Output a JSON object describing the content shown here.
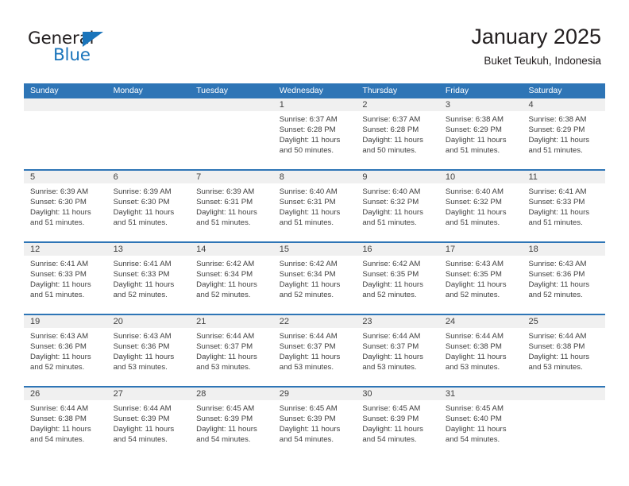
{
  "brand": {
    "name_top": "General",
    "name_bottom": "Blue",
    "accent_color": "#1b75bb"
  },
  "header": {
    "title": "January 2025",
    "subtitle": "Buket Teukuh, Indonesia"
  },
  "theme": {
    "header_row_color": "#2e75b6",
    "daynum_band_color": "#f0f0f0",
    "text_color": "#404040"
  },
  "calendar": {
    "day_headers": [
      "Sunday",
      "Monday",
      "Tuesday",
      "Wednesday",
      "Thursday",
      "Friday",
      "Saturday"
    ],
    "weeks": [
      [
        {
          "day": "",
          "empty": true,
          "lines": []
        },
        {
          "day": "",
          "empty": true,
          "lines": []
        },
        {
          "day": "",
          "empty": true,
          "lines": []
        },
        {
          "day": "1",
          "lines": [
            "Sunrise: 6:37 AM",
            "Sunset: 6:28 PM",
            "Daylight: 11 hours",
            "and 50 minutes."
          ]
        },
        {
          "day": "2",
          "lines": [
            "Sunrise: 6:37 AM",
            "Sunset: 6:28 PM",
            "Daylight: 11 hours",
            "and 50 minutes."
          ]
        },
        {
          "day": "3",
          "lines": [
            "Sunrise: 6:38 AM",
            "Sunset: 6:29 PM",
            "Daylight: 11 hours",
            "and 51 minutes."
          ]
        },
        {
          "day": "4",
          "lines": [
            "Sunrise: 6:38 AM",
            "Sunset: 6:29 PM",
            "Daylight: 11 hours",
            "and 51 minutes."
          ]
        }
      ],
      [
        {
          "day": "5",
          "lines": [
            "Sunrise: 6:39 AM",
            "Sunset: 6:30 PM",
            "Daylight: 11 hours",
            "and 51 minutes."
          ]
        },
        {
          "day": "6",
          "lines": [
            "Sunrise: 6:39 AM",
            "Sunset: 6:30 PM",
            "Daylight: 11 hours",
            "and 51 minutes."
          ]
        },
        {
          "day": "7",
          "lines": [
            "Sunrise: 6:39 AM",
            "Sunset: 6:31 PM",
            "Daylight: 11 hours",
            "and 51 minutes."
          ]
        },
        {
          "day": "8",
          "lines": [
            "Sunrise: 6:40 AM",
            "Sunset: 6:31 PM",
            "Daylight: 11 hours",
            "and 51 minutes."
          ]
        },
        {
          "day": "9",
          "lines": [
            "Sunrise: 6:40 AM",
            "Sunset: 6:32 PM",
            "Daylight: 11 hours",
            "and 51 minutes."
          ]
        },
        {
          "day": "10",
          "lines": [
            "Sunrise: 6:40 AM",
            "Sunset: 6:32 PM",
            "Daylight: 11 hours",
            "and 51 minutes."
          ]
        },
        {
          "day": "11",
          "lines": [
            "Sunrise: 6:41 AM",
            "Sunset: 6:33 PM",
            "Daylight: 11 hours",
            "and 51 minutes."
          ]
        }
      ],
      [
        {
          "day": "12",
          "lines": [
            "Sunrise: 6:41 AM",
            "Sunset: 6:33 PM",
            "Daylight: 11 hours",
            "and 51 minutes."
          ]
        },
        {
          "day": "13",
          "lines": [
            "Sunrise: 6:41 AM",
            "Sunset: 6:33 PM",
            "Daylight: 11 hours",
            "and 52 minutes."
          ]
        },
        {
          "day": "14",
          "lines": [
            "Sunrise: 6:42 AM",
            "Sunset: 6:34 PM",
            "Daylight: 11 hours",
            "and 52 minutes."
          ]
        },
        {
          "day": "15",
          "lines": [
            "Sunrise: 6:42 AM",
            "Sunset: 6:34 PM",
            "Daylight: 11 hours",
            "and 52 minutes."
          ]
        },
        {
          "day": "16",
          "lines": [
            "Sunrise: 6:42 AM",
            "Sunset: 6:35 PM",
            "Daylight: 11 hours",
            "and 52 minutes."
          ]
        },
        {
          "day": "17",
          "lines": [
            "Sunrise: 6:43 AM",
            "Sunset: 6:35 PM",
            "Daylight: 11 hours",
            "and 52 minutes."
          ]
        },
        {
          "day": "18",
          "lines": [
            "Sunrise: 6:43 AM",
            "Sunset: 6:36 PM",
            "Daylight: 11 hours",
            "and 52 minutes."
          ]
        }
      ],
      [
        {
          "day": "19",
          "lines": [
            "Sunrise: 6:43 AM",
            "Sunset: 6:36 PM",
            "Daylight: 11 hours",
            "and 52 minutes."
          ]
        },
        {
          "day": "20",
          "lines": [
            "Sunrise: 6:43 AM",
            "Sunset: 6:36 PM",
            "Daylight: 11 hours",
            "and 53 minutes."
          ]
        },
        {
          "day": "21",
          "lines": [
            "Sunrise: 6:44 AM",
            "Sunset: 6:37 PM",
            "Daylight: 11 hours",
            "and 53 minutes."
          ]
        },
        {
          "day": "22",
          "lines": [
            "Sunrise: 6:44 AM",
            "Sunset: 6:37 PM",
            "Daylight: 11 hours",
            "and 53 minutes."
          ]
        },
        {
          "day": "23",
          "lines": [
            "Sunrise: 6:44 AM",
            "Sunset: 6:37 PM",
            "Daylight: 11 hours",
            "and 53 minutes."
          ]
        },
        {
          "day": "24",
          "lines": [
            "Sunrise: 6:44 AM",
            "Sunset: 6:38 PM",
            "Daylight: 11 hours",
            "and 53 minutes."
          ]
        },
        {
          "day": "25",
          "lines": [
            "Sunrise: 6:44 AM",
            "Sunset: 6:38 PM",
            "Daylight: 11 hours",
            "and 53 minutes."
          ]
        }
      ],
      [
        {
          "day": "26",
          "lines": [
            "Sunrise: 6:44 AM",
            "Sunset: 6:38 PM",
            "Daylight: 11 hours",
            "and 54 minutes."
          ]
        },
        {
          "day": "27",
          "lines": [
            "Sunrise: 6:44 AM",
            "Sunset: 6:39 PM",
            "Daylight: 11 hours",
            "and 54 minutes."
          ]
        },
        {
          "day": "28",
          "lines": [
            "Sunrise: 6:45 AM",
            "Sunset: 6:39 PM",
            "Daylight: 11 hours",
            "and 54 minutes."
          ]
        },
        {
          "day": "29",
          "lines": [
            "Sunrise: 6:45 AM",
            "Sunset: 6:39 PM",
            "Daylight: 11 hours",
            "and 54 minutes."
          ]
        },
        {
          "day": "30",
          "lines": [
            "Sunrise: 6:45 AM",
            "Sunset: 6:39 PM",
            "Daylight: 11 hours",
            "and 54 minutes."
          ]
        },
        {
          "day": "31",
          "lines": [
            "Sunrise: 6:45 AM",
            "Sunset: 6:40 PM",
            "Daylight: 11 hours",
            "and 54 minutes."
          ]
        },
        {
          "day": "",
          "empty": true,
          "lines": []
        }
      ]
    ]
  }
}
